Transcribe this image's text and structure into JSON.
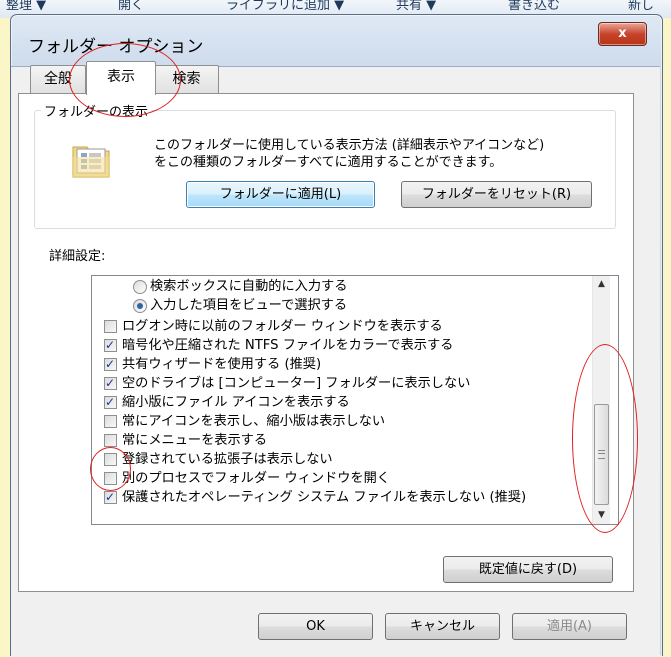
{
  "background_toolbar": [
    "整理 ▼",
    "開く",
    "ライブラリに追加 ▼",
    "共有 ▼",
    "書き込む",
    "新し"
  ],
  "dialog": {
    "title": "フォルダー オプション",
    "close_label": "x"
  },
  "tabs": [
    {
      "label": "全般",
      "active": false
    },
    {
      "label": "表示",
      "active": true
    },
    {
      "label": "検索",
      "active": false
    }
  ],
  "folder_view": {
    "group_label": "フォルダーの表示",
    "description_line1": "このフォルダーに使用している表示方法 (詳細表示やアイコンなど)",
    "description_line2": "をこの種類のフォルダーすべてに適用することができます。",
    "apply_button": "フォルダーに適用(L)",
    "reset_button": "フォルダーをリセット(R)"
  },
  "advanced": {
    "label": "詳細設定:",
    "items": [
      {
        "type": "radio",
        "checked": false,
        "label": "検索ボックスに自動的に入力する"
      },
      {
        "type": "radio",
        "checked": true,
        "label": "入力した項目をビューで選択する"
      },
      {
        "type": "checkbox",
        "checked": false,
        "label": "ログオン時に以前のフォルダー ウィンドウを表示する"
      },
      {
        "type": "checkbox",
        "checked": true,
        "label": "暗号化や圧縮された NTFS ファイルをカラーで表示する"
      },
      {
        "type": "checkbox",
        "checked": true,
        "label": "共有ウィザードを使用する (推奨)"
      },
      {
        "type": "checkbox",
        "checked": true,
        "label": "空のドライブは [コンピューター] フォルダーに表示しない"
      },
      {
        "type": "checkbox",
        "checked": true,
        "label": "縮小版にファイル アイコンを表示する"
      },
      {
        "type": "checkbox",
        "checked": false,
        "label": "常にアイコンを表示し、縮小版は表示しない"
      },
      {
        "type": "checkbox",
        "checked": false,
        "label": "常にメニューを表示する"
      },
      {
        "type": "checkbox",
        "checked": false,
        "label": "登録されている拡張子は表示しない"
      },
      {
        "type": "checkbox",
        "checked": false,
        "label": "別のプロセスでフォルダー ウィンドウを開く"
      },
      {
        "type": "checkbox",
        "checked": true,
        "label": "保護されたオペレーティング システム ファイルを表示しない (推奨)"
      }
    ],
    "restore_button": "既定値に戻す(D)"
  },
  "footer": {
    "ok": "OK",
    "cancel": "キャンセル",
    "apply": "適用(A)"
  },
  "colors": {
    "annotation": "#e02020",
    "dialog_frame": "#c4d4e8",
    "close_button": "#c7442c"
  }
}
